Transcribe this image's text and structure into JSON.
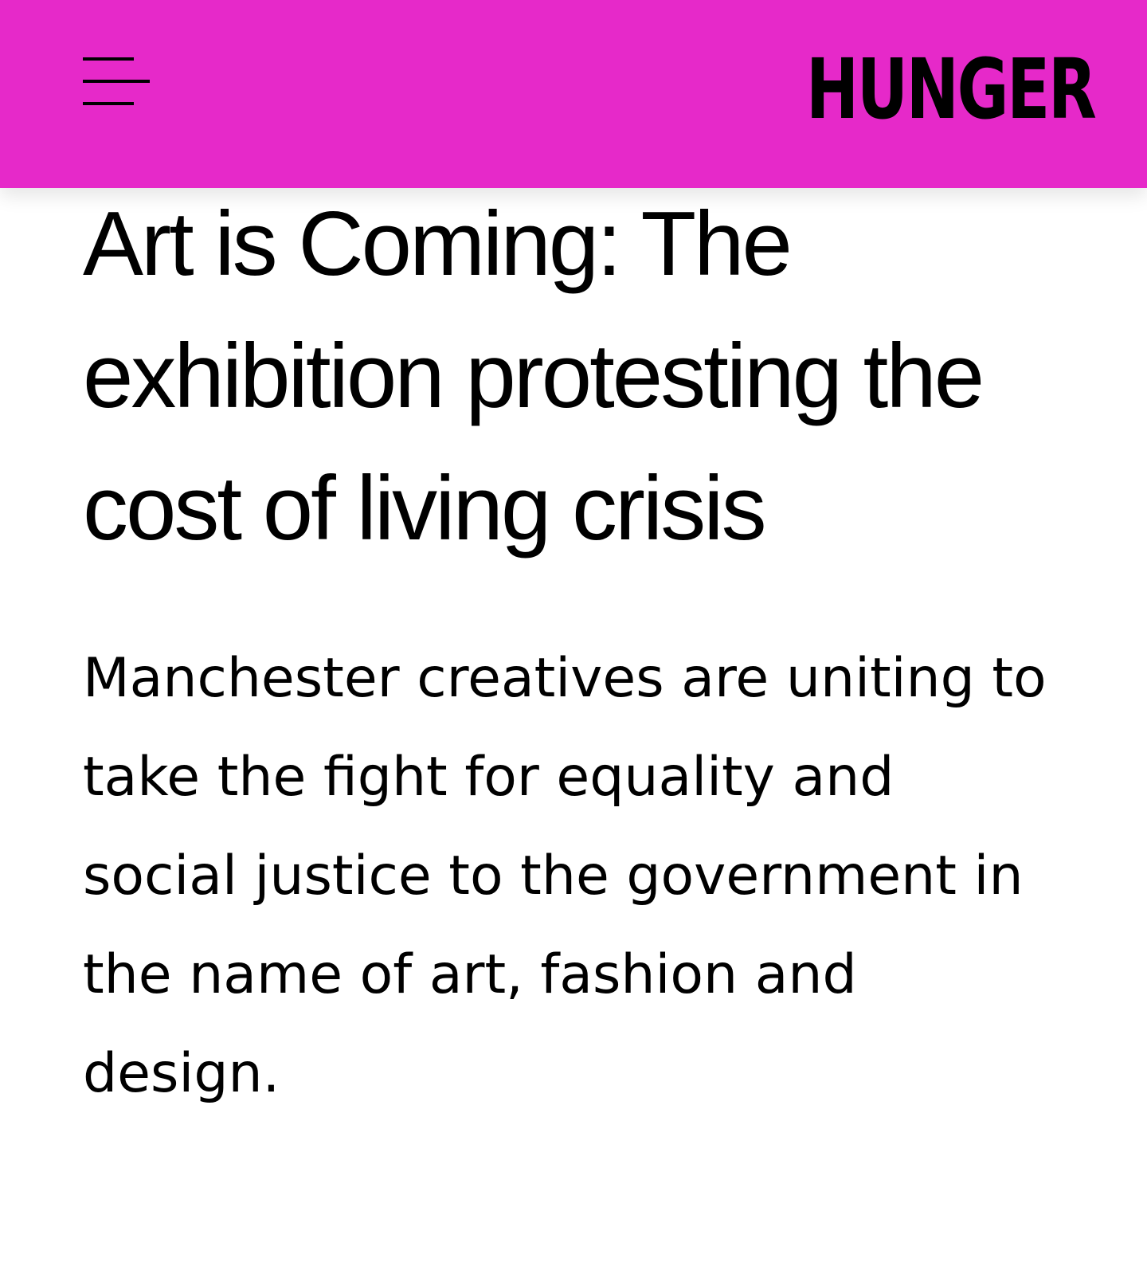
{
  "header": {
    "background_color": "#e629c9",
    "menu_icon": "hamburger-menu-icon",
    "logo_text": "HUNGER"
  },
  "article": {
    "title": "Art is Coming: The exhibition protesting the cost of living crisis",
    "standfirst": "Manchester creatives are uniting to take the fight for equality and social justice to the government in the name of art, fashion and design."
  }
}
